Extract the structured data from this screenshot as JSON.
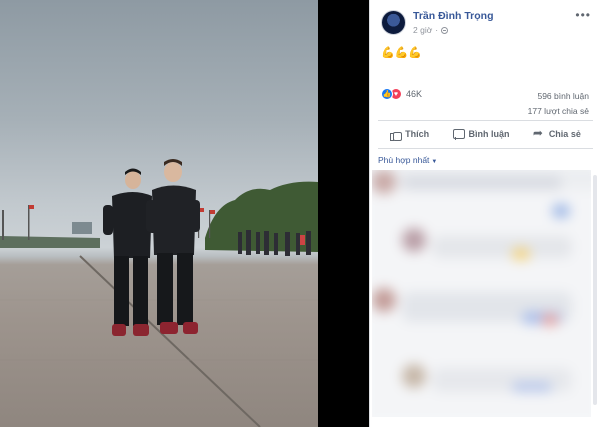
{
  "post": {
    "author": "Trần Đình Trọng",
    "time": "2 giờ",
    "privacy_icon": "globe-icon",
    "text": "💪💪💪",
    "more_label": "•••"
  },
  "stats": {
    "reaction_count": "46K",
    "comments": "596 bình luận",
    "shares": "177 lượt chia sẻ"
  },
  "actions": {
    "like": "Thích",
    "comment": "Bình luận",
    "share": "Chia sẻ"
  },
  "comments": {
    "sort_label": "Phù hợp nhất"
  },
  "colors": {
    "link": "#385898",
    "like": "#1877f2",
    "love": "#f33e58"
  }
}
